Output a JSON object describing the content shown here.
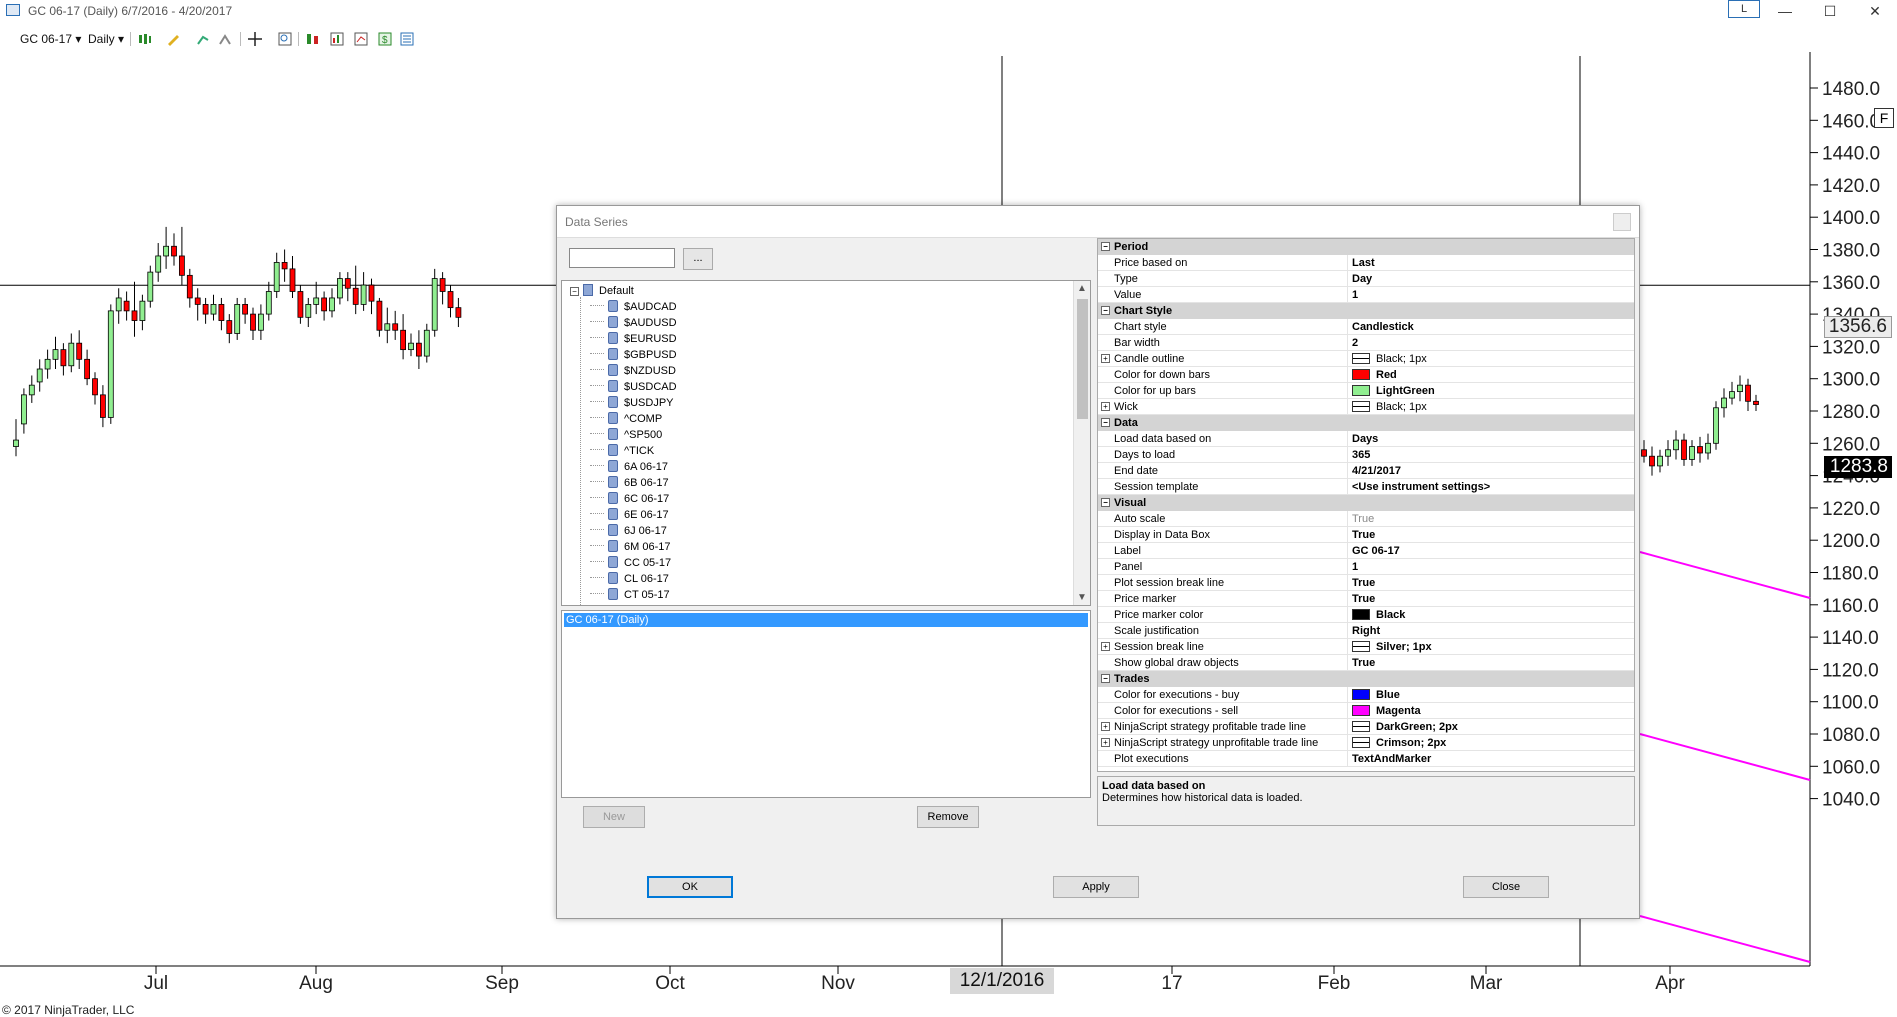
{
  "window": {
    "title": "GC 06-17 (Daily)  6/7/2016 - 4/20/2017",
    "badge": "L",
    "controls": [
      "—",
      "☐",
      "✕"
    ]
  },
  "toolbar": {
    "instrument": "GC 06-17",
    "interval": "Daily"
  },
  "chart": {
    "copyright": "© 2017 NinjaTrader, LLC",
    "f_button": "F",
    "price_ticks": [
      "1480.0",
      "1460.0",
      "1440.0",
      "1420.0",
      "1400.0",
      "1380.0",
      "1360.0",
      "1340.0",
      "1320.0",
      "1300.0",
      "1280.0",
      "1260.0",
      "1240.0",
      "1220.0",
      "1200.0",
      "1180.0",
      "1160.0",
      "1140.0",
      "1120.0",
      "1100.0",
      "1080.0",
      "1060.0",
      "1040.0"
    ],
    "date_ticks": [
      "Jul",
      "Aug",
      "Sep",
      "Oct",
      "Nov",
      "17",
      "Feb",
      "Mar",
      "Apr"
    ],
    "crosshair_price": "1356.6",
    "last_price": "1283.8",
    "crosshair_date": "12/1/2016",
    "colors": {
      "up": "#90ee90",
      "down": "#ff0000",
      "trend_line": "#ff00ff"
    }
  },
  "dialog": {
    "title": "Data Series",
    "search_button": "...",
    "tree": {
      "root": "Default",
      "items": [
        "$AUDCAD",
        "$AUDUSD",
        "$EURUSD",
        "$GBPUSD",
        "$NZDUSD",
        "$USDCAD",
        "$USDJPY",
        "^COMP",
        "^SP500",
        "^TICK",
        "6A 06-17",
        "6B 06-17",
        "6C 06-17",
        "6E 06-17",
        "6J 06-17",
        "6M 06-17",
        "CC 05-17",
        "CL 06-17",
        "CT 05-17"
      ]
    },
    "series_selected": "GC 06-17 (Daily)",
    "buttons": {
      "new": "New",
      "remove": "Remove",
      "ok": "OK",
      "apply": "Apply",
      "close": "Close"
    },
    "properties": [
      {
        "category": "Period",
        "rows": [
          {
            "name": "Price based on",
            "value": "Last"
          },
          {
            "name": "Type",
            "value": "Day"
          },
          {
            "name": "Value",
            "value": "1"
          }
        ]
      },
      {
        "category": "Chart Style",
        "rows": [
          {
            "name": "Chart style",
            "value": "Candlestick"
          },
          {
            "name": "Bar width",
            "value": "2"
          },
          {
            "name": "Candle outline",
            "value": "Black; 1px",
            "swatch": "line",
            "expand": true,
            "plain": true
          },
          {
            "name": "Color for down bars",
            "value": "Red",
            "swatch": "#ff0000"
          },
          {
            "name": "Color for up bars",
            "value": "LightGreen",
            "swatch": "#90ee90"
          },
          {
            "name": "Wick",
            "value": "Black; 1px",
            "swatch": "line",
            "expand": true,
            "plain": true
          }
        ]
      },
      {
        "category": "Data",
        "rows": [
          {
            "name": "Load data based on",
            "value": "Days"
          },
          {
            "name": "Days to load",
            "value": "365"
          },
          {
            "name": "End date",
            "value": "4/21/2017"
          },
          {
            "name": "Session template",
            "value": "<Use instrument settings>"
          }
        ]
      },
      {
        "category": "Visual",
        "rows": [
          {
            "name": "Auto scale",
            "value": "True",
            "greyed": true
          },
          {
            "name": "Display in Data Box",
            "value": "True"
          },
          {
            "name": "Label",
            "value": "GC 06-17"
          },
          {
            "name": "Panel",
            "value": "1"
          },
          {
            "name": "Plot session break line",
            "value": "True"
          },
          {
            "name": "Price marker",
            "value": "True"
          },
          {
            "name": "Price marker color",
            "value": "Black",
            "swatch": "#000000"
          },
          {
            "name": "Scale justification",
            "value": "Right"
          },
          {
            "name": "Session break line",
            "value": "Silver; 1px",
            "swatch": "line",
            "expand": true
          },
          {
            "name": "Show global draw objects",
            "value": "True"
          }
        ]
      },
      {
        "category": "Trades",
        "rows": [
          {
            "name": "Color for executions - buy",
            "value": "Blue",
            "swatch": "#0000ff"
          },
          {
            "name": "Color for executions - sell",
            "value": "Magenta",
            "swatch": "#ff00ff"
          },
          {
            "name": "NinjaScript strategy profitable trade line",
            "value": "DarkGreen; 2px",
            "swatch": "line",
            "expand": true
          },
          {
            "name": "NinjaScript strategy unprofitable trade line",
            "value": "Crimson; 2px",
            "swatch": "line",
            "expand": true
          },
          {
            "name": "Plot executions",
            "value": "TextAndMarker"
          }
        ]
      }
    ],
    "description": {
      "title": "Load data based on",
      "text": "Determines how historical data is loaded."
    }
  }
}
